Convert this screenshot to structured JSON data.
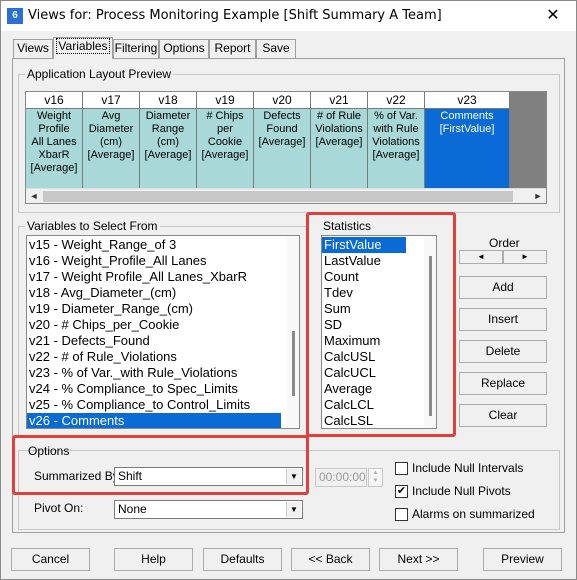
{
  "window": {
    "title": "Views for: Process Monitoring Example [Shift Summary A Team]",
    "icon": "6",
    "close": "✕"
  },
  "tabs": [
    {
      "label": "Views"
    },
    {
      "label": "Variables"
    },
    {
      "label": "Filtering"
    },
    {
      "label": "Options"
    },
    {
      "label": "Report"
    },
    {
      "label": "Save"
    }
  ],
  "preview": {
    "label": "Application Layout Preview",
    "columns": [
      {
        "head": "v16",
        "body": "Weight Profile\nAll Lanes\nXbarR\n[Average]"
      },
      {
        "head": "v17",
        "body": "Avg\nDiameter\n(cm)\n[Average]"
      },
      {
        "head": "v18",
        "body": "Diameter\nRange\n(cm)\n[Average]"
      },
      {
        "head": "v19",
        "body": "# Chips\nper\nCookie\n[Average]"
      },
      {
        "head": "v20",
        "body": "Defects\nFound\n[Average]"
      },
      {
        "head": "v21",
        "body": "# of Rule\nViolations\n[Average]"
      },
      {
        "head": "v22",
        "body": "% of Var.\nwith Rule\nViolations\n[Average]"
      },
      {
        "head": "v23",
        "body": "Comments\n[FirstValue]"
      }
    ]
  },
  "variables": {
    "label": "Variables to Select From",
    "items": [
      "v15 - Weight_Range_of 3",
      "v16 - Weight_Profile_All Lanes",
      "v17 - Weight Profile_All Lanes_XbarR",
      "v18 - Avg_Diameter_(cm)",
      "v19 - Diameter_Range_(cm)",
      "v20 - # Chips_per_Cookie",
      "v21 - Defects_Found",
      "v22 - # of Rule_Violations",
      "v23 - % of Var._with Rule_Violations",
      "v24 - % Compliance_to Spec_Limits",
      "v25 - % Compliance_to Control_Limits",
      "v26 - Comments"
    ]
  },
  "statistics": {
    "label": "Statistics",
    "items": [
      "FirstValue",
      "LastValue",
      "Count",
      "Tdev",
      "Sum",
      "SD",
      "Maximum",
      "CalcUSL",
      "CalcUCL",
      "Average",
      "CalcLCL",
      "CalcLSL"
    ]
  },
  "order": {
    "label": "Order",
    "left": "◄",
    "right": "►",
    "buttons": [
      "Add",
      "Insert",
      "Delete",
      "Replace",
      "Clear"
    ]
  },
  "options": {
    "label": "Options",
    "summarized_label": "Summarized By:",
    "summarized_value": "Shift",
    "pivot_label": "Pivot On:",
    "pivot_value": "None",
    "time_value": "00:00:00",
    "include_null_intervals": "Include Null Intervals",
    "include_null_pivots": "Include Null Pivots",
    "alarms_on_summarized": "Alarms on summarized",
    "checkmark": "✔"
  },
  "footer": {
    "cancel": "Cancel",
    "help": "Help",
    "defaults": "Defaults",
    "back": "<< Back",
    "next": "Next >>",
    "preview": "Preview"
  },
  "colors": {
    "highlight": "#0b6bd6",
    "preview_cell": "#a8d8d8",
    "annotation": "#e0403a"
  }
}
